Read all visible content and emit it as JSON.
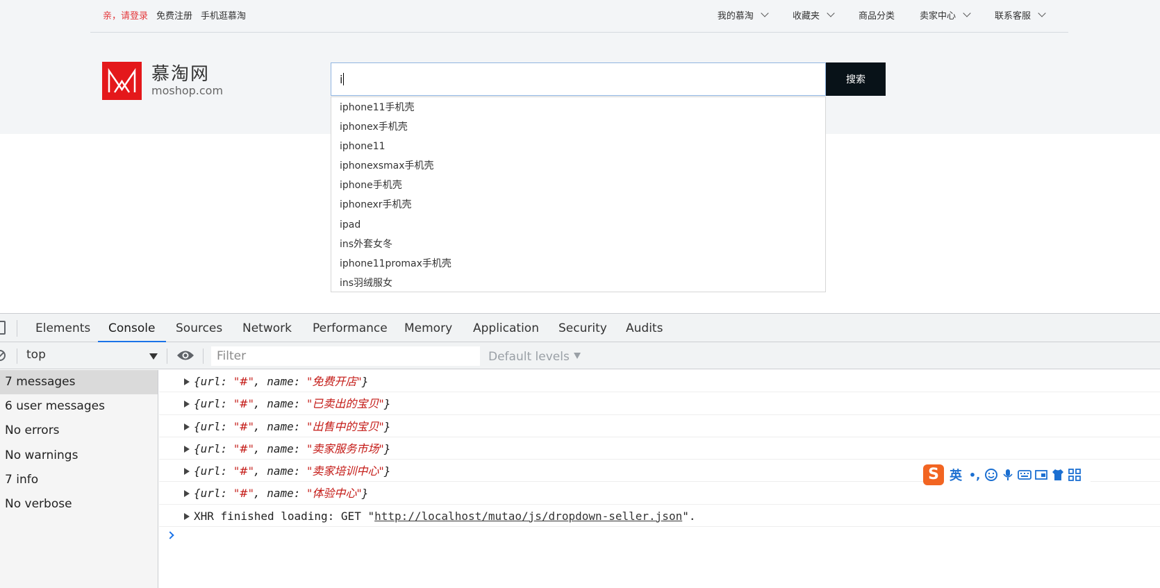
{
  "topbar": {
    "left": [
      {
        "label": "亲，请登录"
      },
      {
        "label": "免费注册"
      },
      {
        "label": "手机逛慕淘"
      }
    ],
    "right": [
      {
        "label": "我的慕淘",
        "has_dropdown": true
      },
      {
        "label": "收藏夹",
        "has_dropdown": true
      },
      {
        "label": "商品分类",
        "has_dropdown": false
      },
      {
        "label": "卖家中心",
        "has_dropdown": true
      },
      {
        "label": "联系客服",
        "has_dropdown": true
      }
    ]
  },
  "logo": {
    "title": "慕淘网",
    "subtitle": "moshop.com",
    "color": "#e4181b"
  },
  "search": {
    "value": "i",
    "button_label": "搜索",
    "suggestions": [
      "iphone11手机壳",
      "iphonex手机壳",
      "iphone11",
      "iphonexsmax手机壳",
      "iphone手机壳",
      "iphonexr手机壳",
      "ipad",
      "ins外套女冬",
      "iphone11promax手机壳",
      "ins羽绒服女"
    ]
  },
  "devtools": {
    "tabs": [
      "Elements",
      "Console",
      "Sources",
      "Network",
      "Performance",
      "Memory",
      "Application",
      "Security",
      "Audits"
    ],
    "active_tab": "Console",
    "toolbar": {
      "context": "top",
      "filter_placeholder": "Filter",
      "levels": "Default levels"
    },
    "sidebar": [
      {
        "label": "7 messages",
        "selected": true
      },
      {
        "label": "6 user messages"
      },
      {
        "label": "No errors"
      },
      {
        "label": "No warnings"
      },
      {
        "label": "7 info"
      },
      {
        "label": "No verbose"
      }
    ],
    "logs": [
      {
        "url": "#",
        "name": "免费开店"
      },
      {
        "url": "#",
        "name": "已卖出的宝贝"
      },
      {
        "url": "#",
        "name": "出售中的宝贝"
      },
      {
        "url": "#",
        "name": "卖家服务市场"
      },
      {
        "url": "#",
        "name": "卖家培训中心"
      },
      {
        "url": "#",
        "name": "体验中心"
      }
    ],
    "xhr": {
      "prefix": "XHR finished loading: GET \"",
      "url": "http://localhost/mutao/js/dropdown-seller.json",
      "suffix": "\"."
    }
  },
  "ime": {
    "logo": "S",
    "lang": "英"
  }
}
